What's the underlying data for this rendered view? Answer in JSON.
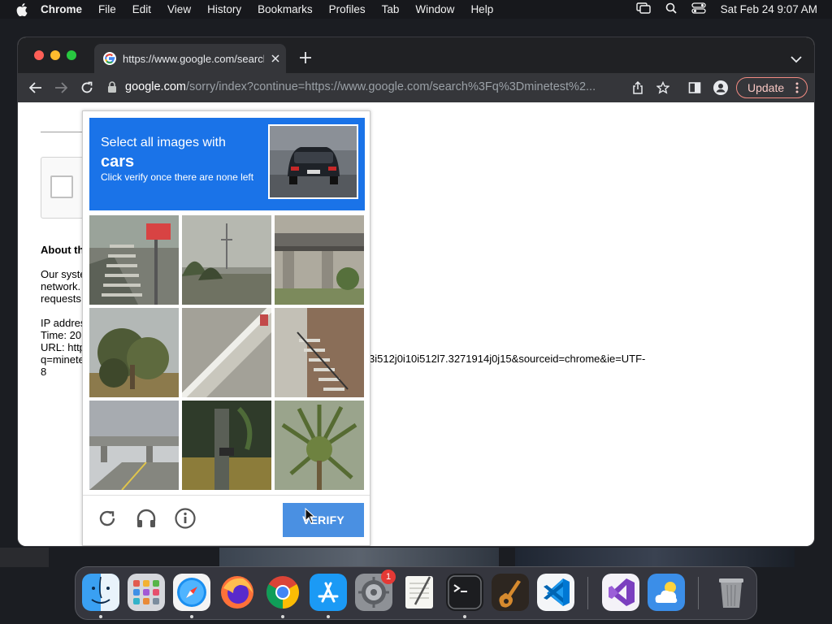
{
  "menubar": {
    "app_name": "Chrome",
    "items": [
      "File",
      "Edit",
      "View",
      "History",
      "Bookmarks",
      "Profiles",
      "Tab",
      "Window",
      "Help"
    ],
    "clock": "Sat Feb 24  9:07 AM"
  },
  "browser": {
    "tab_title": "https://www.google.com/search?q=minetest",
    "url_host": "google.com",
    "url_path": "/sorry/index?continue=https://www.google.com/search%3Fq%3Dminetest%2...",
    "update_label": "Update"
  },
  "page": {
    "heading": "About th",
    "para_lines": [
      "Our syste",
      "network.",
      "requests"
    ],
    "ip_lines": [
      "IP addres",
      "Time: 20",
      "URL: http",
      "q=minete"
    ],
    "url_tail": "3i512j0i10i512l7.3271914j0j15&sourceid=chrome&ie=UTF-",
    "url_tail_last": "8"
  },
  "captcha": {
    "line1": "Select all images with",
    "target": "cars",
    "line3": "Click verify once there are none left",
    "tiles": [
      "stairs",
      "bridge-trees",
      "overpass",
      "tree",
      "stairs-wall",
      "stairs-building",
      "highway-bridge",
      "palm-dark",
      "palm-tree"
    ],
    "verify_label": "VERIFY"
  },
  "dock": {
    "apps": [
      "Finder",
      "Launchpad",
      "Safari",
      "Firefox",
      "Google Chrome",
      "App Store",
      "System Preferences",
      "TextEdit",
      "Terminal",
      "GarageBand",
      "Visual Studio Code",
      "Visual Studio",
      "Weather",
      "Trash"
    ],
    "settings_badge": "1"
  },
  "colors": {
    "captcha_header": "#1a73e8",
    "verify_button": "#4a90e2",
    "toolbar": "#35363a",
    "tabstrip": "#202124"
  }
}
